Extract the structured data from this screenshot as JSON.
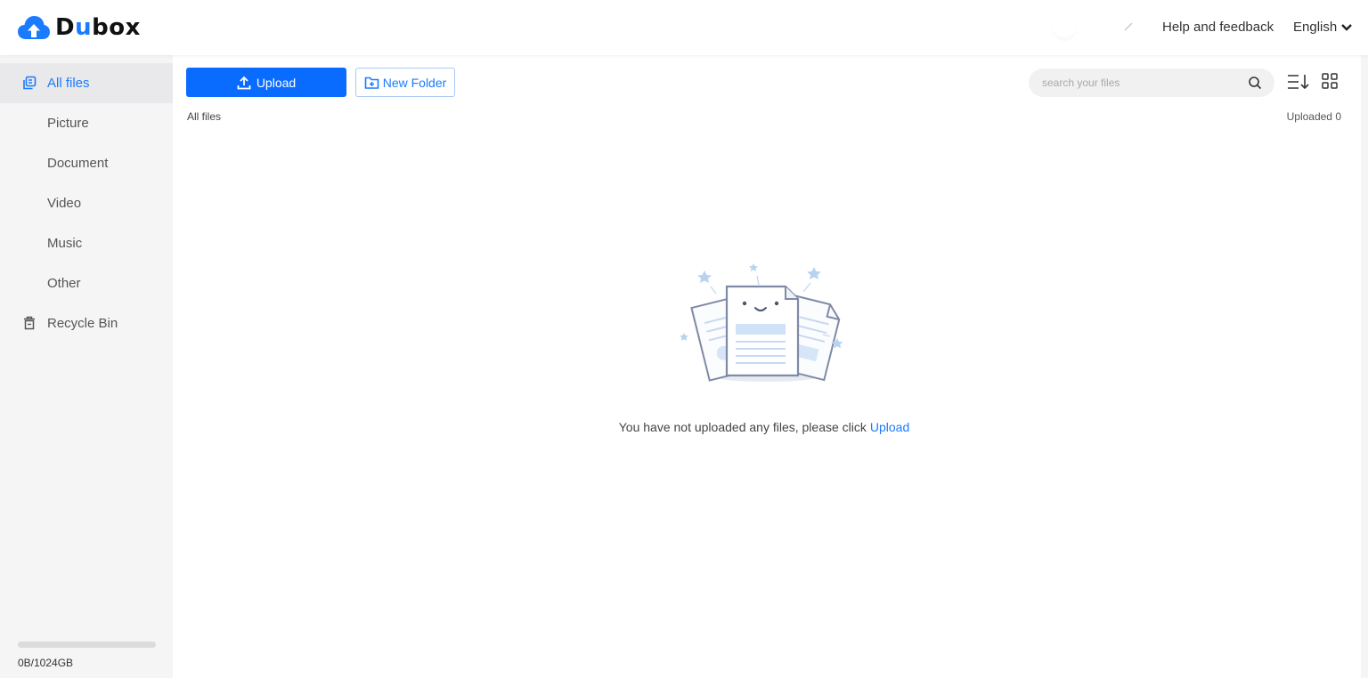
{
  "app": {
    "logo_prefix": "D",
    "logo_u": "u",
    "logo_suffix": "box",
    "brand_color": "#1a7bff"
  },
  "header": {
    "help_label": "Help and feedback",
    "language_label": "English"
  },
  "sidebar": {
    "items": [
      {
        "label": "All files",
        "icon": "files-icon",
        "active": true
      },
      {
        "label": "Picture"
      },
      {
        "label": "Document"
      },
      {
        "label": "Video"
      },
      {
        "label": "Music"
      },
      {
        "label": "Other"
      },
      {
        "label": "Recycle Bin",
        "icon": "trash-icon"
      }
    ],
    "storage": {
      "text": "0B/1024GB",
      "used_fraction": 0
    }
  },
  "toolbar": {
    "upload_label": "Upload",
    "new_folder_label": "New Folder",
    "search_placeholder": "search your files"
  },
  "main": {
    "breadcrumb": "All files",
    "uploaded_text": "Uploaded 0",
    "empty_message": "You have not uploaded any files, please click",
    "empty_link": "Upload"
  }
}
